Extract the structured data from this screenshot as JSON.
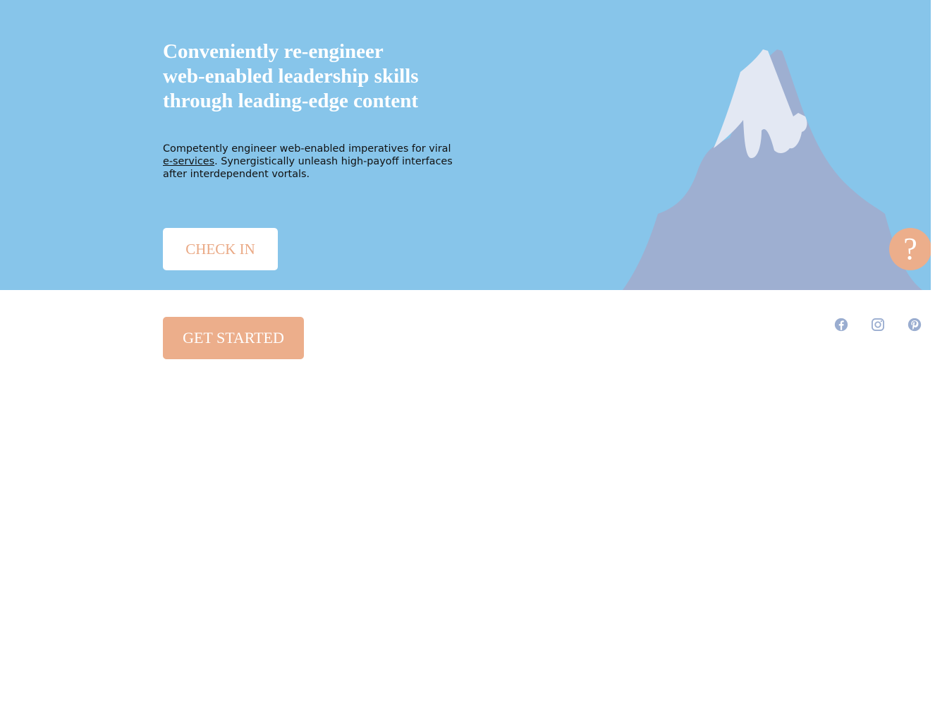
{
  "hero": {
    "headline_lines": [
      "Conveniently re-engineer",
      "web-enabled leadership skills",
      "through leading-edge content"
    ],
    "description": {
      "line1": "Competently engineer web-enabled imperatives for viral",
      "link_text": "e-services",
      "line2_rest": ". Synergistically unleash high-payoff interfaces",
      "line3": "after interdependent vortals."
    },
    "checkin_label": "CHECK IN",
    "help_label": "?"
  },
  "cta": {
    "get_started_label": "GET STARTED"
  },
  "social": {
    "icons": [
      "facebook-icon",
      "instagram-icon",
      "pinterest-icon"
    ],
    "color": "#9aadd0"
  },
  "colors": {
    "hero_bg": "#87c5ea",
    "accent": "#ecae8b",
    "mountain": "#9eafd1",
    "snow": "#e3e8f3"
  }
}
